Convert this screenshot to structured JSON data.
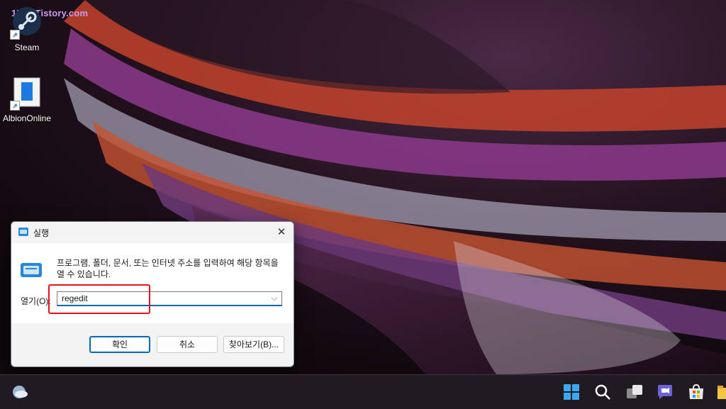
{
  "watermark": "1710.Tistory.com",
  "desktop": {
    "icons": [
      {
        "label": "Steam",
        "icon": "steam-icon"
      },
      {
        "label": "AlbionOnline",
        "icon": "albion-online-icon"
      }
    ]
  },
  "run_dialog": {
    "title": "실행",
    "description": "프로그램, 폴더, 문서, 또는 인터넷 주소를 입력하여 해당 항목을 열 수 있습니다.",
    "open_label": "열기(O):",
    "open_value": "regedit",
    "buttons": {
      "ok": "확인",
      "cancel": "취소",
      "browse": "찾아보기(B)..."
    },
    "close_glyph": "✕",
    "dropdown_glyph": "⌵"
  },
  "taskbar": {
    "items": [
      "weather-icon",
      "start-icon",
      "search-icon",
      "task-view-icon",
      "chat-icon",
      "store-icon",
      "file-explorer-icon"
    ]
  },
  "colors": {
    "accent": "#0067c0",
    "highlight_box": "#e3141b",
    "watermark": "#cf9bf0"
  }
}
